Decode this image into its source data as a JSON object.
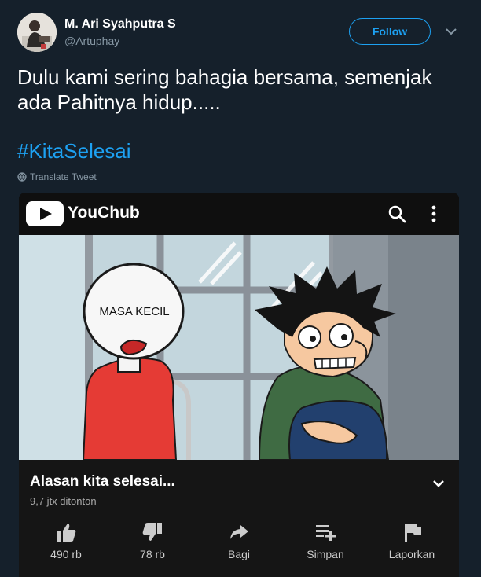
{
  "tweet": {
    "author_name": "M. Ari Syahputra S",
    "author_handle": "@Artuphay",
    "follow_label": "Follow",
    "text_line1": "Dulu kami sering bahagia bersama, semenjak",
    "text_line2": "ada Pahitnya hidup.....",
    "hashtag": "#KitaSelesai",
    "translate_label": "Translate Tweet"
  },
  "video_card": {
    "app_name": "YouChub",
    "thumbnail_caption": "MASA KECIL",
    "video_title": "Alasan kita selesai...",
    "views": "9,7 jtx ditonton",
    "actions": [
      {
        "icon": "thumbs-up-icon",
        "label": "490 rb"
      },
      {
        "icon": "thumbs-down-icon",
        "label": "78 rb"
      },
      {
        "icon": "share-icon",
        "label": "Bagi"
      },
      {
        "icon": "playlist-add-icon",
        "label": "Simpan"
      },
      {
        "icon": "flag-icon",
        "label": "Laporkan"
      }
    ]
  },
  "colors": {
    "background": "#15202b",
    "accent": "#1da1f2",
    "card_bg": "#0f0f0f",
    "secondary_text": "#8899a6"
  }
}
